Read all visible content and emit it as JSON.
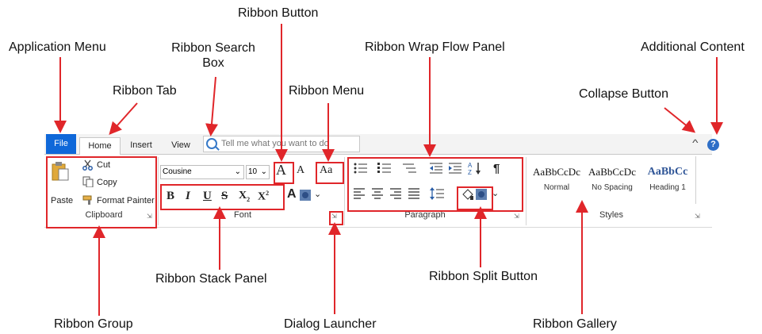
{
  "callouts": {
    "ribbon_button": "Ribbon Button",
    "application_menu": "Application Menu",
    "search_box_line1": "Ribbon Search",
    "search_box_line2": "Box",
    "wrap_flow_panel": "Ribbon Wrap Flow Panel",
    "additional_content": "Additional Content",
    "ribbon_tab": "Ribbon Tab",
    "ribbon_menu": "Ribbon Menu",
    "collapse_button": "Collapse Button",
    "ribbon_group": "Ribbon Group",
    "stack_panel": "Ribbon Stack Panel",
    "dialog_launcher": "Dialog Launcher",
    "split_button": "Ribbon Split Button",
    "gallery": "Ribbon Gallery"
  },
  "ribbon": {
    "tabs": {
      "file": "File",
      "home": "Home",
      "insert": "Insert",
      "view": "View"
    },
    "search_placeholder": "Tell me what you want to do",
    "help_glyph": "?",
    "collapse_glyph": "^",
    "clipboard": {
      "paste": "Paste",
      "cut": "Cut",
      "copy": "Copy",
      "format_painter": "Format Painter",
      "label": "Clipboard"
    },
    "font": {
      "name": "Cousine",
      "size": "10",
      "grow": "A",
      "shrink": "A",
      "case": "Aa",
      "bold": "B",
      "italic": "I",
      "underline": "U",
      "strike": "S",
      "subscript": "X",
      "superscript": "X",
      "color": "A",
      "label": "Font"
    },
    "paragraph": {
      "label": "Paragraph",
      "pilcrow": "¶"
    },
    "styles": {
      "label": "Styles",
      "items": [
        {
          "sample": "AaBbCcDc",
          "name": "Normal"
        },
        {
          "sample": "AaBbCcDc",
          "name": "No Spacing"
        },
        {
          "sample": "AaBbCc",
          "name": "Heading 1"
        }
      ]
    }
  },
  "colors": {
    "accent": "#0f68d9",
    "highlight": "#e0262a",
    "arrow": "#e0262a"
  }
}
